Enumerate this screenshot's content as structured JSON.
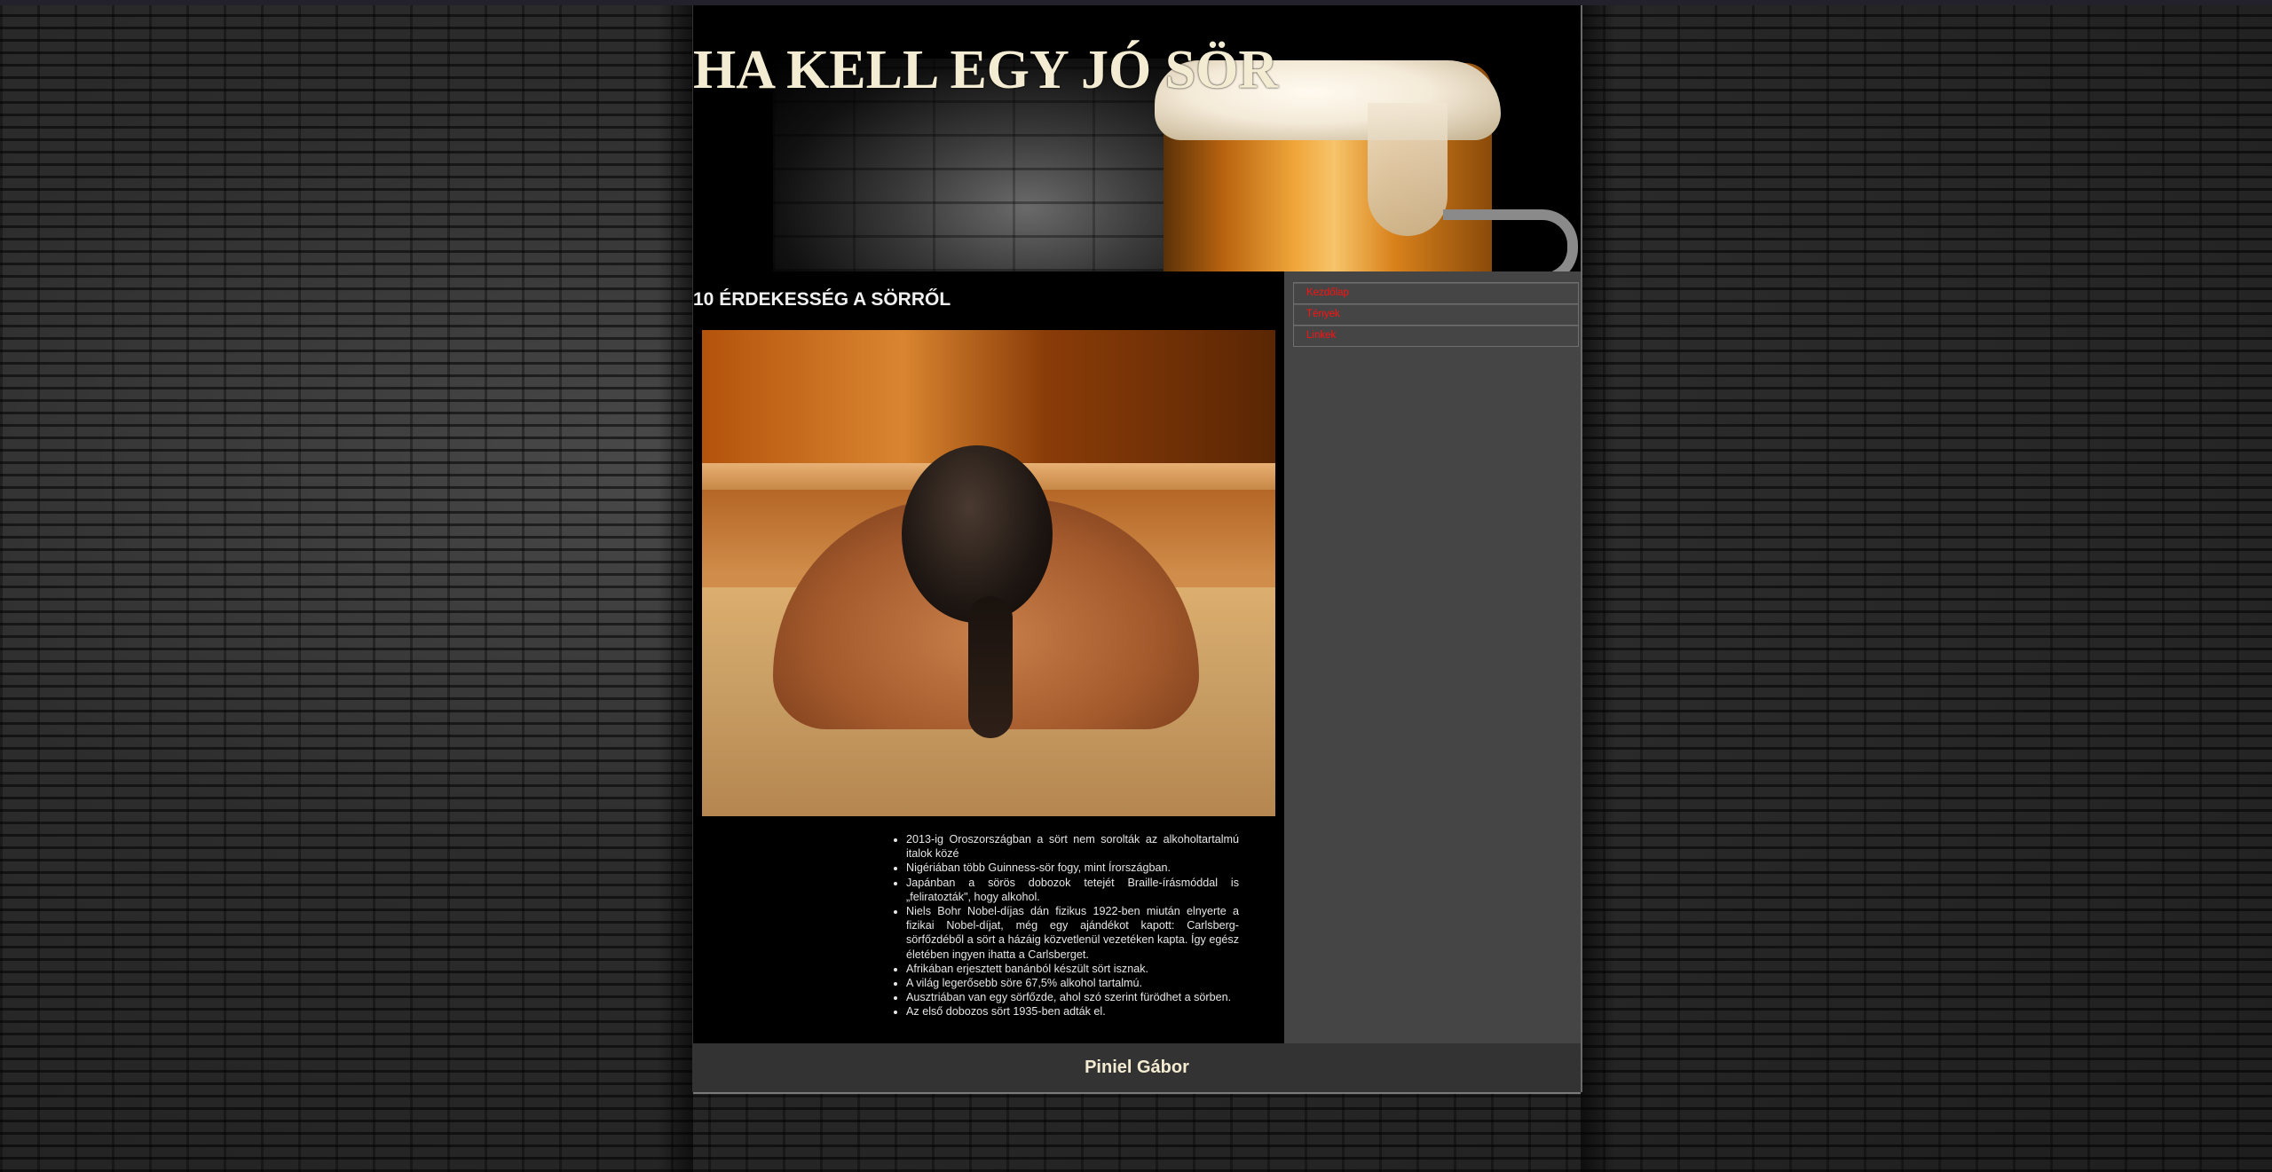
{
  "header": {
    "title": "HA KELL EGY JÓ SÖR"
  },
  "main": {
    "heading": "10 ÉRDEKESSÉG A SÖRRŐL",
    "facts": [
      "2013-ig Oroszországban a sört nem sorolták az alkoholtartalmú italok közé",
      "Nigériában több Guinness-sör fogy, mint Írországban.",
      "Japánban a sörös dobozok tetejét Braille-írásmóddal is „feliratozták\", hogy alkohol.",
      "Niels Bohr Nobel-díjas dán fizikus 1922-ben miután elnyerte a fizikai Nobel-díjat, még egy ajándékot kapott: Carlsberg-sörfőzdéből a sört a házáig közvetlenül vezetéken kapta. Így egész életében ingyen ihatta a Carlsberget.",
      "Afrikában erjesztett banánból készült sört isznak.",
      "A világ legerősebb söre 67,5% alkohol tartalmú.",
      "Ausztriában van egy sörfőzde, ahol szó szerint fürödhet a sörben.",
      "Az első dobozos sört 1935-ben adták el."
    ]
  },
  "sidebar": {
    "menu": [
      {
        "label": "Kezdőlap"
      },
      {
        "label": "Tények"
      },
      {
        "label": "Linkek"
      }
    ]
  },
  "footer": {
    "author": "Piniel Gábor"
  },
  "colors": {
    "menu_link": "#ff1111",
    "title": "#f3ecd2",
    "sidebar_bg": "#454545",
    "footer_bg": "#333333"
  }
}
